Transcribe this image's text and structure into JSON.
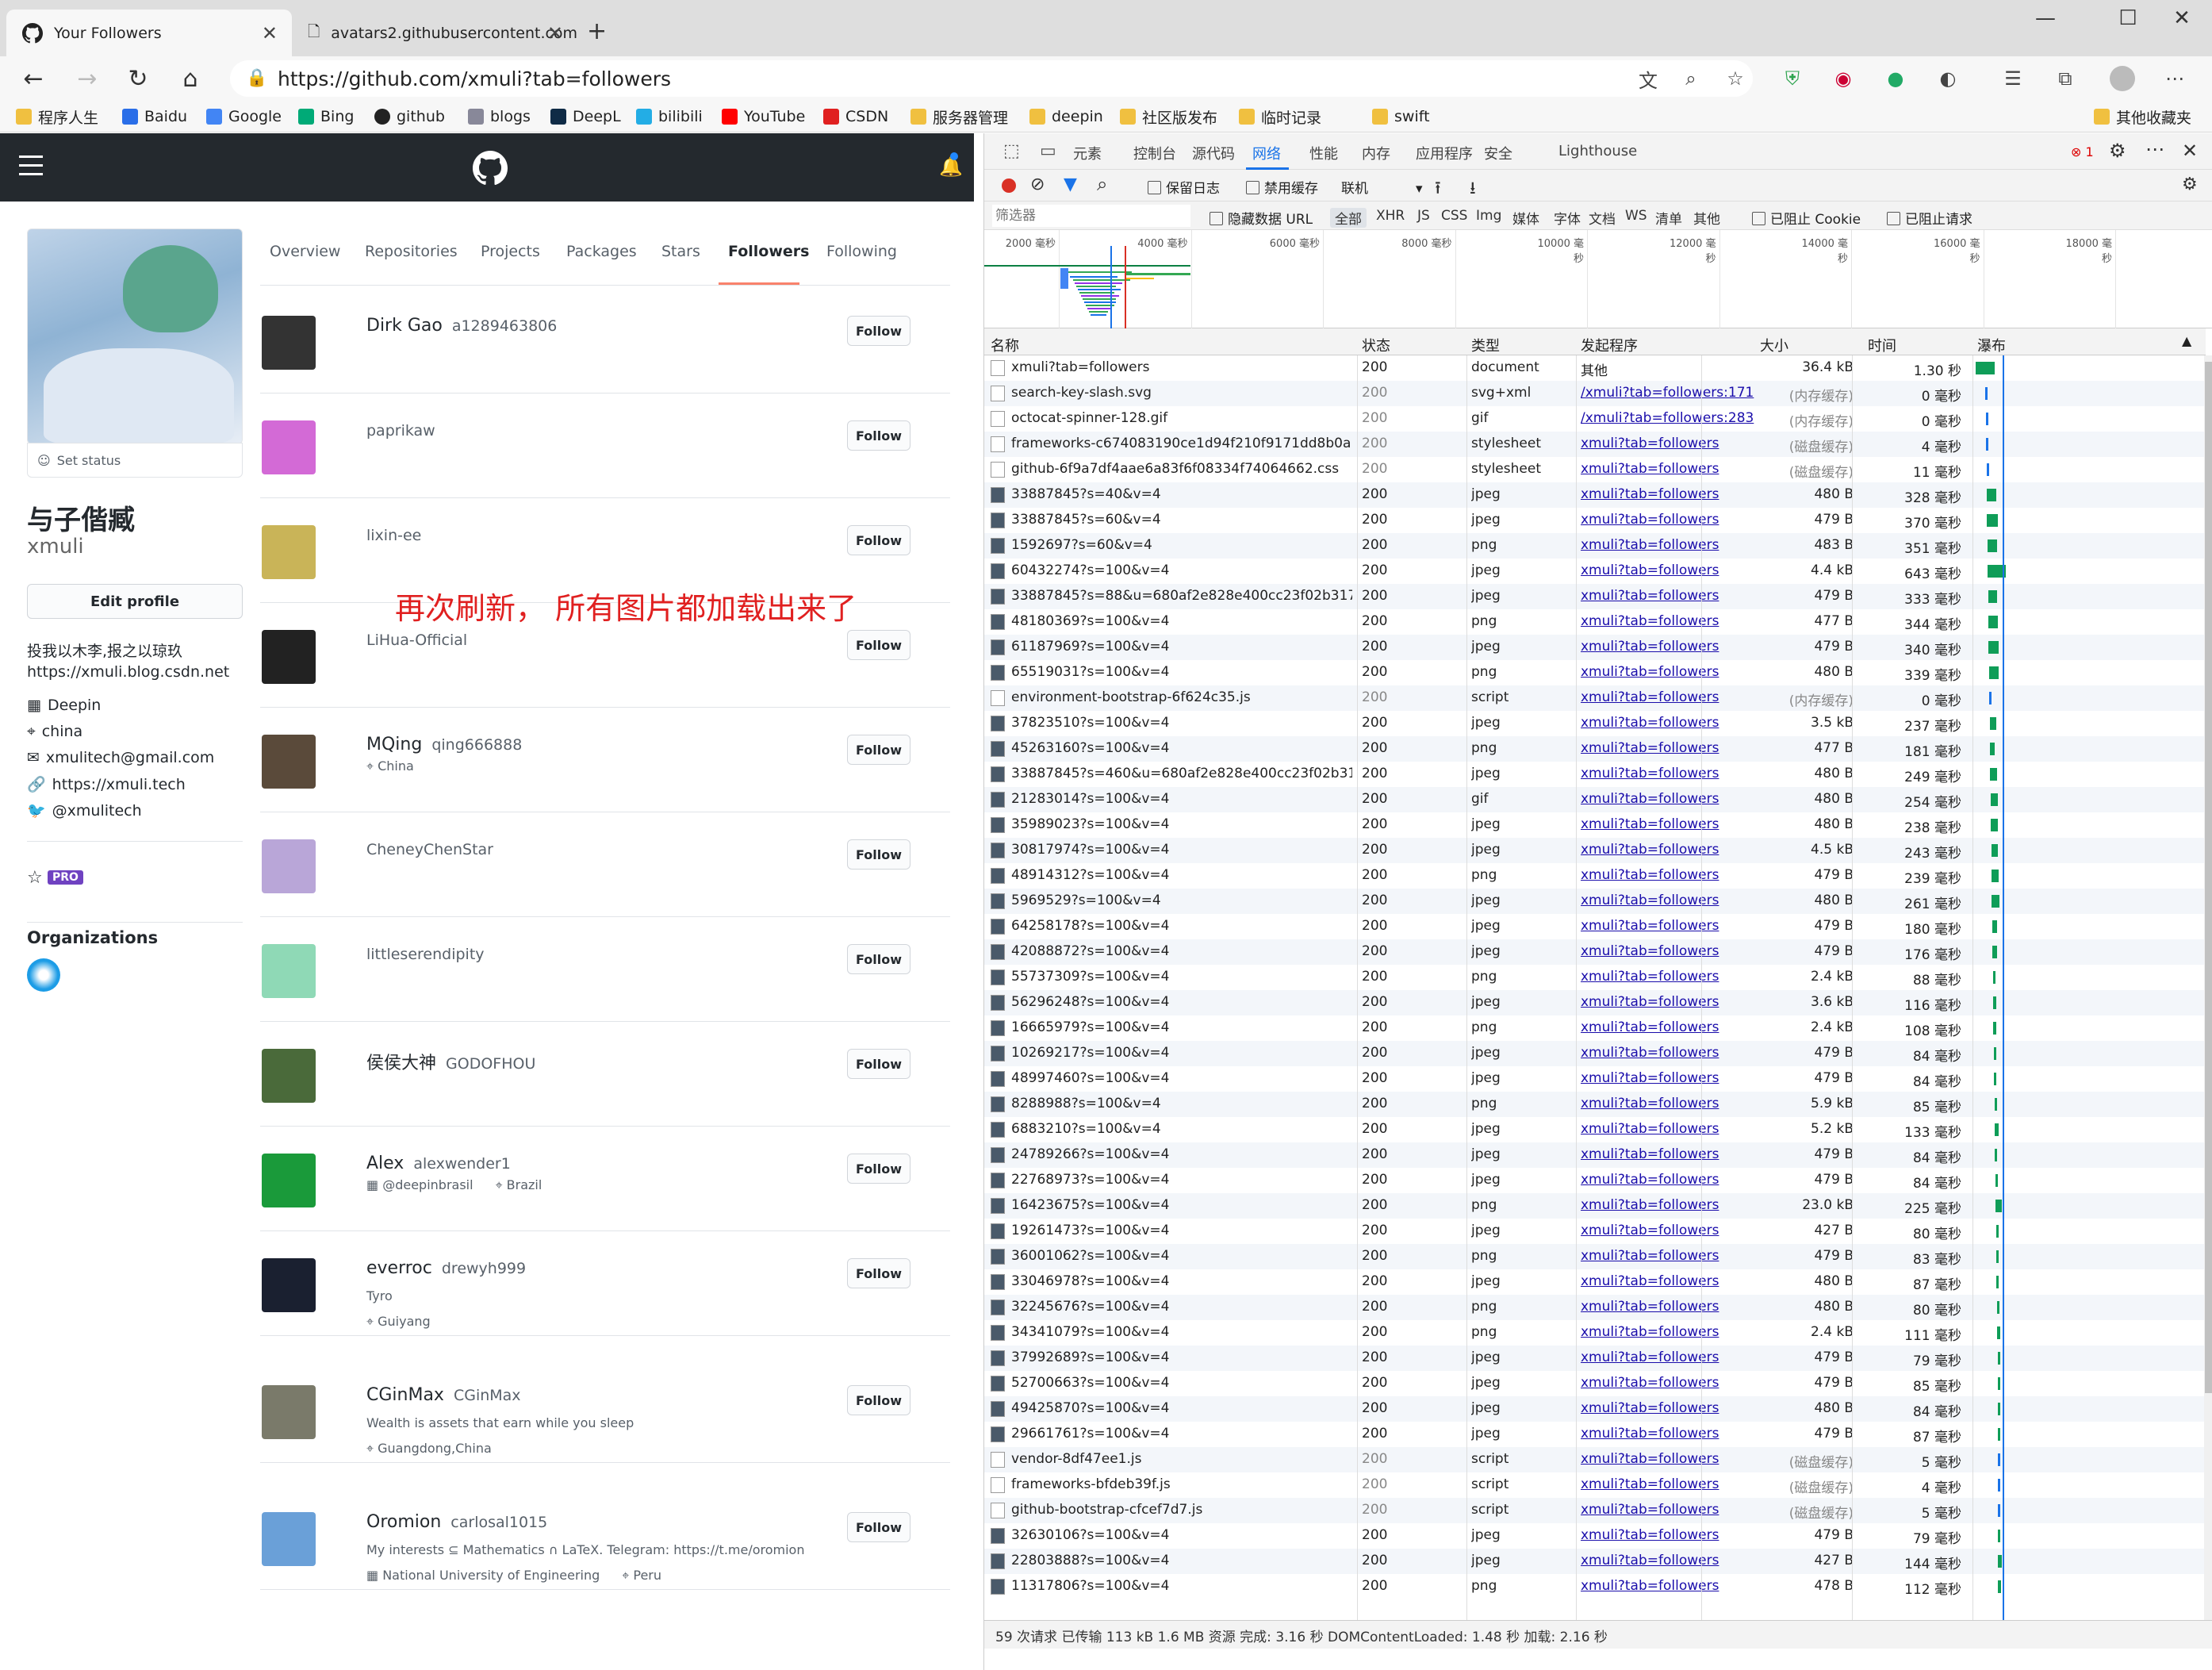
{
  "browser": {
    "tabs": [
      {
        "title": "Your Followers"
      },
      {
        "title": "avatars2.githubusercontent.com"
      }
    ],
    "url": "https://github.com/xmuli?tab=followers",
    "bookmarks": [
      "程序人生",
      "Baidu",
      "Google",
      "Bing",
      "github",
      "blogs",
      "DeepL",
      "bilibili",
      "YouTube",
      "CSDN",
      "服务器管理",
      "deepin",
      "社区版发布",
      "临时记录",
      "swift"
    ],
    "other_bookmarks": "其他收藏夹"
  },
  "github": {
    "nav_tabs": [
      "Overview",
      "Repositories",
      "Projects",
      "Packages",
      "Stars",
      "Followers",
      "Following"
    ],
    "active_tab": "Followers",
    "set_status": "Set status",
    "display_name": "与子偕臧",
    "login": "xmuli",
    "edit_profile": "Edit profile",
    "bio": "投我以木李,报之以琼玖",
    "blog_line": "https://xmuli.blog.csdn.net",
    "company": "Deepin",
    "location": "china",
    "email": "xmulitech@gmail.com",
    "website": "https://xmuli.tech",
    "twitter": "@xmulitech",
    "pro_badge": "PRO",
    "organizations_heading": "Organizations",
    "annotation": "再次刷新， 所有图片都加载出来了",
    "follow_label": "Follow",
    "followers": [
      {
        "name": "Dirk Gao",
        "login": "a1289463806",
        "bio": "",
        "company": "",
        "location": "",
        "color": "#333"
      },
      {
        "name": "",
        "login": "paprikaw",
        "bio": "",
        "company": "",
        "location": "",
        "color": "#d36ad6"
      },
      {
        "name": "",
        "login": "lixin-ee",
        "bio": "",
        "company": "",
        "location": "",
        "color": "#c9b458"
      },
      {
        "name": "",
        "login": "LiHua-Official",
        "bio": "",
        "company": "",
        "location": "",
        "color": "#222"
      },
      {
        "name": "MQing",
        "login": "qing666888",
        "bio": "",
        "company": "",
        "location": "China",
        "color": "#5a4a3a"
      },
      {
        "name": "",
        "login": "CheneyChenStar",
        "bio": "",
        "company": "",
        "location": "",
        "color": "#b9a6d8"
      },
      {
        "name": "",
        "login": "littleserendipity",
        "bio": "",
        "company": "",
        "location": "",
        "color": "#8fd9b6"
      },
      {
        "name": "侯侯大神",
        "login": "GODOFHOU",
        "bio": "",
        "company": "",
        "location": "",
        "color": "#4a6a3a"
      },
      {
        "name": "Alex",
        "login": "alexwender1",
        "bio": "",
        "company": "@deepinbrasil",
        "location": "Brazil",
        "color": "#1a9a3a"
      },
      {
        "name": "everroc",
        "login": "drewyh999",
        "bio": "Tyro",
        "company": "",
        "location": "Guiyang",
        "color": "#1a2030"
      },
      {
        "name": "CGinMax",
        "login": "CGinMax",
        "bio": "Wealth is assets that earn while you sleep",
        "company": "",
        "location": "Guangdong,China",
        "color": "#7a7a6a"
      },
      {
        "name": "Oromion",
        "login": "carlosal1015",
        "bio": "My interests ⊆ Mathematics ∩ LaTeX. Telegram: https://t.me/oromion",
        "company": "National University of Engineering",
        "location": "Peru",
        "color": "#6aa0d8"
      }
    ]
  },
  "devtools": {
    "tabs": [
      "元素",
      "控制台",
      "源代码",
      "网络",
      "性能",
      "内存",
      "应用程序",
      "安全",
      "Lighthouse"
    ],
    "active_tab": "网络",
    "error_count": "1",
    "toolbar": {
      "preserve_log": "保留日志",
      "disable_cache": "禁用缓存",
      "throttle": "联机"
    },
    "filter_placeholder": "筛选器",
    "filter_options": {
      "hide_data_urls": "隐藏数据 URL",
      "types": [
        "全部",
        "XHR",
        "JS",
        "CSS",
        "Img",
        "媒体",
        "字体",
        "文档",
        "WS",
        "清单",
        "其他"
      ],
      "blocked_cookies": "已阻止 Cookie",
      "blocked_requests": "已阻止请求"
    },
    "timeline_ticks": [
      "2000 毫秒",
      "4000 毫秒",
      "6000 毫秒",
      "8000 毫秒",
      "10000 毫秒",
      "12000 毫秒",
      "14000 毫秒",
      "16000 毫秒",
      "18000 毫秒"
    ],
    "columns": [
      "名称",
      "状态",
      "类型",
      "发起程序",
      "大小",
      "时间",
      "瀑布"
    ],
    "rows": [
      [
        "xmuli?tab=followers",
        "200",
        "document",
        "其他",
        "36.4 kB",
        "1.30 秒"
      ],
      [
        "search-key-slash.svg",
        "200",
        "svg+xml",
        "/xmuli?tab=followers:171",
        "(内存缓存)",
        "0 毫秒"
      ],
      [
        "octocat-spinner-128.gif",
        "200",
        "gif",
        "/xmuli?tab=followers:283",
        "(内存缓存)",
        "0 毫秒"
      ],
      [
        "frameworks-c674083190ce1d94f210f9171dd8b0a...",
        "200",
        "stylesheet",
        "xmuli?tab=followers",
        "(磁盘缓存)",
        "4 毫秒"
      ],
      [
        "github-6f9a7df4aae6a83f6f08334f74064662.css",
        "200",
        "stylesheet",
        "xmuli?tab=followers",
        "(磁盘缓存)",
        "11 毫秒"
      ],
      [
        "33887845?s=40&v=4",
        "200",
        "jpeg",
        "xmuli?tab=followers",
        "480 B",
        "328 毫秒"
      ],
      [
        "33887845?s=60&v=4",
        "200",
        "jpeg",
        "xmuli?tab=followers",
        "479 B",
        "370 毫秒"
      ],
      [
        "1592697?s=60&v=4",
        "200",
        "png",
        "xmuli?tab=followers",
        "483 B",
        "351 毫秒"
      ],
      [
        "60432274?s=100&v=4",
        "200",
        "jpeg",
        "xmuli?tab=followers",
        "4.4 kB",
        "643 毫秒"
      ],
      [
        "33887845?s=88&u=680af2e828e400cc23f02b317...",
        "200",
        "jpeg",
        "xmuli?tab=followers",
        "479 B",
        "333 毫秒"
      ],
      [
        "48180369?s=100&v=4",
        "200",
        "png",
        "xmuli?tab=followers",
        "477 B",
        "344 毫秒"
      ],
      [
        "61187969?s=100&v=4",
        "200",
        "jpeg",
        "xmuli?tab=followers",
        "479 B",
        "340 毫秒"
      ],
      [
        "65519031?s=100&v=4",
        "200",
        "png",
        "xmuli?tab=followers",
        "480 B",
        "339 毫秒"
      ],
      [
        "environment-bootstrap-6f624c35.js",
        "200",
        "script",
        "xmuli?tab=followers",
        "(内存缓存)",
        "0 毫秒"
      ],
      [
        "37823510?s=100&v=4",
        "200",
        "jpeg",
        "xmuli?tab=followers",
        "3.5 kB",
        "237 毫秒"
      ],
      [
        "45263160?s=100&v=4",
        "200",
        "png",
        "xmuli?tab=followers",
        "477 B",
        "181 毫秒"
      ],
      [
        "33887845?s=460&u=680af2e828e400cc23f02b31...",
        "200",
        "jpeg",
        "xmuli?tab=followers",
        "480 B",
        "249 毫秒"
      ],
      [
        "21283014?s=100&v=4",
        "200",
        "gif",
        "xmuli?tab=followers",
        "480 B",
        "254 毫秒"
      ],
      [
        "35989023?s=100&v=4",
        "200",
        "jpeg",
        "xmuli?tab=followers",
        "480 B",
        "238 毫秒"
      ],
      [
        "30817974?s=100&v=4",
        "200",
        "jpeg",
        "xmuli?tab=followers",
        "4.5 kB",
        "243 毫秒"
      ],
      [
        "48914312?s=100&v=4",
        "200",
        "png",
        "xmuli?tab=followers",
        "479 B",
        "239 毫秒"
      ],
      [
        "5969529?s=100&v=4",
        "200",
        "jpeg",
        "xmuli?tab=followers",
        "480 B",
        "261 毫秒"
      ],
      [
        "64258178?s=100&v=4",
        "200",
        "jpeg",
        "xmuli?tab=followers",
        "479 B",
        "180 毫秒"
      ],
      [
        "42088872?s=100&v=4",
        "200",
        "jpeg",
        "xmuli?tab=followers",
        "479 B",
        "176 毫秒"
      ],
      [
        "55737309?s=100&v=4",
        "200",
        "png",
        "xmuli?tab=followers",
        "2.4 kB",
        "88 毫秒"
      ],
      [
        "56296248?s=100&v=4",
        "200",
        "jpeg",
        "xmuli?tab=followers",
        "3.6 kB",
        "116 毫秒"
      ],
      [
        "16665979?s=100&v=4",
        "200",
        "png",
        "xmuli?tab=followers",
        "2.4 kB",
        "108 毫秒"
      ],
      [
        "10269217?s=100&v=4",
        "200",
        "jpeg",
        "xmuli?tab=followers",
        "479 B",
        "84 毫秒"
      ],
      [
        "48997460?s=100&v=4",
        "200",
        "jpeg",
        "xmuli?tab=followers",
        "479 B",
        "84 毫秒"
      ],
      [
        "8288988?s=100&v=4",
        "200",
        "png",
        "xmuli?tab=followers",
        "5.9 kB",
        "85 毫秒"
      ],
      [
        "6883210?s=100&v=4",
        "200",
        "jpeg",
        "xmuli?tab=followers",
        "5.2 kB",
        "133 毫秒"
      ],
      [
        "24789266?s=100&v=4",
        "200",
        "jpeg",
        "xmuli?tab=followers",
        "479 B",
        "84 毫秒"
      ],
      [
        "22768973?s=100&v=4",
        "200",
        "jpeg",
        "xmuli?tab=followers",
        "479 B",
        "84 毫秒"
      ],
      [
        "16423675?s=100&v=4",
        "200",
        "png",
        "xmuli?tab=followers",
        "23.0 kB",
        "225 毫秒"
      ],
      [
        "19261473?s=100&v=4",
        "200",
        "jpeg",
        "xmuli?tab=followers",
        "427 B",
        "80 毫秒"
      ],
      [
        "36001062?s=100&v=4",
        "200",
        "png",
        "xmuli?tab=followers",
        "479 B",
        "83 毫秒"
      ],
      [
        "33046978?s=100&v=4",
        "200",
        "jpeg",
        "xmuli?tab=followers",
        "480 B",
        "87 毫秒"
      ],
      [
        "32245676?s=100&v=4",
        "200",
        "png",
        "xmuli?tab=followers",
        "480 B",
        "80 毫秒"
      ],
      [
        "34341079?s=100&v=4",
        "200",
        "png",
        "xmuli?tab=followers",
        "2.4 kB",
        "111 毫秒"
      ],
      [
        "37992689?s=100&v=4",
        "200",
        "jpeg",
        "xmuli?tab=followers",
        "479 B",
        "79 毫秒"
      ],
      [
        "52700663?s=100&v=4",
        "200",
        "jpeg",
        "xmuli?tab=followers",
        "479 B",
        "85 毫秒"
      ],
      [
        "49425870?s=100&v=4",
        "200",
        "jpeg",
        "xmuli?tab=followers",
        "480 B",
        "84 毫秒"
      ],
      [
        "29661761?s=100&v=4",
        "200",
        "jpeg",
        "xmuli?tab=followers",
        "479 B",
        "87 毫秒"
      ],
      [
        "vendor-8df47ee1.js",
        "200",
        "script",
        "xmuli?tab=followers",
        "(磁盘缓存)",
        "5 毫秒"
      ],
      [
        "frameworks-bfdeb39f.js",
        "200",
        "script",
        "xmuli?tab=followers",
        "(磁盘缓存)",
        "4 毫秒"
      ],
      [
        "github-bootstrap-cfcef7d7.js",
        "200",
        "script",
        "xmuli?tab=followers",
        "(磁盘缓存)",
        "5 毫秒"
      ],
      [
        "32630106?s=100&v=4",
        "200",
        "jpeg",
        "xmuli?tab=followers",
        "479 B",
        "79 毫秒"
      ],
      [
        "22803888?s=100&v=4",
        "200",
        "jpeg",
        "xmuli?tab=followers",
        "427 B",
        "144 毫秒"
      ],
      [
        "11317806?s=100&v=4",
        "200",
        "png",
        "xmuli?tab=followers",
        "478 B",
        "112 毫秒"
      ]
    ],
    "status_bar": "59 次请求  已传输 113 kB  1.6 MB 资源  完成: 3.16 秒  DOMContentLoaded: 1.48 秒  加载: 2.16 秒"
  }
}
